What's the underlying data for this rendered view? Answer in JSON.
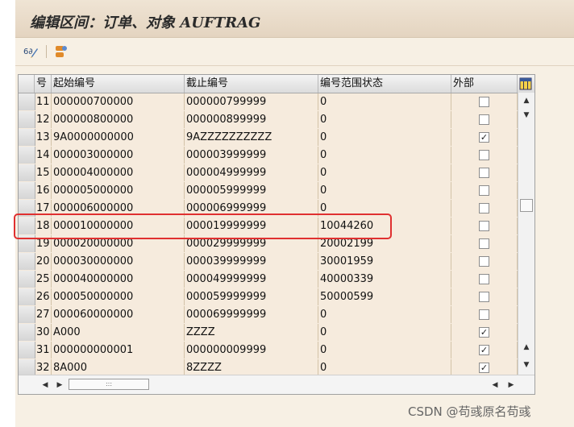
{
  "window": {
    "title": "编辑区间：订单、对象 AUFTRAG"
  },
  "toolbar": {
    "buttons": [
      {
        "name": "display-change-icon",
        "glyph": "6∂"
      },
      {
        "name": "interval-icon",
        "glyph": "⇆"
      }
    ]
  },
  "table": {
    "columns": [
      "号",
      "起始编号",
      "截止编号",
      "编号范围状态",
      "外部"
    ],
    "rows": [
      {
        "no": "11",
        "start": "000000700000",
        "end": "000000799999",
        "status": "0",
        "ext": false
      },
      {
        "no": "12",
        "start": "000000800000",
        "end": "000000899999",
        "status": "0",
        "ext": false
      },
      {
        "no": "13",
        "start": "9A0000000000",
        "end": "9AZZZZZZZZZZ",
        "status": "0",
        "ext": true
      },
      {
        "no": "14",
        "start": "000003000000",
        "end": "000003999999",
        "status": "0",
        "ext": false
      },
      {
        "no": "15",
        "start": "000004000000",
        "end": "000004999999",
        "status": "0",
        "ext": false
      },
      {
        "no": "16",
        "start": "000005000000",
        "end": "000005999999",
        "status": "0",
        "ext": false
      },
      {
        "no": "17",
        "start": "000006000000",
        "end": "000006999999",
        "status": "0",
        "ext": false
      },
      {
        "no": "18",
        "start": "000010000000",
        "end": "000019999999",
        "status": "10044260",
        "ext": false
      },
      {
        "no": "19",
        "start": "000020000000",
        "end": "000029999999",
        "status": "20002199",
        "ext": false
      },
      {
        "no": "20",
        "start": "000030000000",
        "end": "000039999999",
        "status": "30001959",
        "ext": false
      },
      {
        "no": "25",
        "start": "000040000000",
        "end": "000049999999",
        "status": "40000339",
        "ext": false
      },
      {
        "no": "26",
        "start": "000050000000",
        "end": "000059999999",
        "status": "50000599",
        "ext": false
      },
      {
        "no": "27",
        "start": "000060000000",
        "end": "000069999999",
        "status": "0",
        "ext": false
      },
      {
        "no": "30",
        "start": "A000",
        "end": "ZZZZ",
        "status": "0",
        "ext": true
      },
      {
        "no": "31",
        "start": "000000000001",
        "end": "000000009999",
        "status": "0",
        "ext": true
      },
      {
        "no": "32",
        "start": "8A000",
        "end": "8ZZZZ",
        "status": "0",
        "ext": true
      }
    ]
  },
  "scroll": {
    "up": "▲",
    "down": "▼",
    "left": "◀",
    "right": "▶",
    "grip": ":::"
  },
  "watermark": "CSDN @苟彧原名苟彧",
  "colors": {
    "row_bg": "#f6ebdd",
    "highlight": "#e03030"
  }
}
